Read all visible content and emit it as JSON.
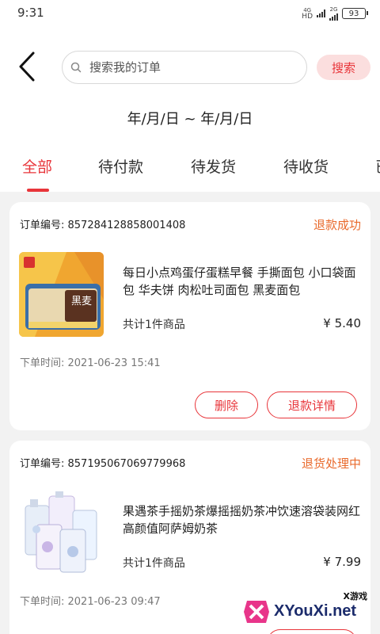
{
  "status_bar": {
    "time": "9:31",
    "net1_top": "4G",
    "net1_bottom": "HD",
    "net2_top": "2G",
    "battery": "93"
  },
  "search": {
    "placeholder": "搜索我的订单",
    "button_label": "搜索"
  },
  "date_range": "年/月/日 ~ 年/月/日",
  "tabs": [
    {
      "label": "全部",
      "active": true
    },
    {
      "label": "待付款"
    },
    {
      "label": "待发货"
    },
    {
      "label": "待收货"
    },
    {
      "label": "已"
    }
  ],
  "orders": [
    {
      "order_no": "订单编号: 857284128858001408",
      "status": "退款成功",
      "product_name": "每日小点鸡蛋仔蛋糕早餐 手撕面包 小口袋面包 华夫饼 肉松吐司面包 黑麦面包",
      "thumb_text": "黑麦",
      "count": "共计1件商品",
      "price": "¥ 5.40",
      "order_time": "下单时间: 2021-06-23 15:41",
      "buttons": [
        "删除",
        "退款详情"
      ]
    },
    {
      "order_no": "订单编号: 857195067069779968",
      "status": "退货处理中",
      "product_name": "果遇茶手摇奶茶爆摇摇奶茶冲饮速溶袋装网红高颜值阿萨姆奶茶",
      "count": "共计1件商品",
      "price": "¥ 7.99",
      "order_time": "下单时间: 2021-06-23 09:47"
    }
  ],
  "watermark": {
    "small": "X游戏",
    "big": "XYouXi.net"
  },
  "colors": {
    "accent": "#e8353a",
    "status_orange": "#e96a2c",
    "background": "#f2f2f2"
  }
}
